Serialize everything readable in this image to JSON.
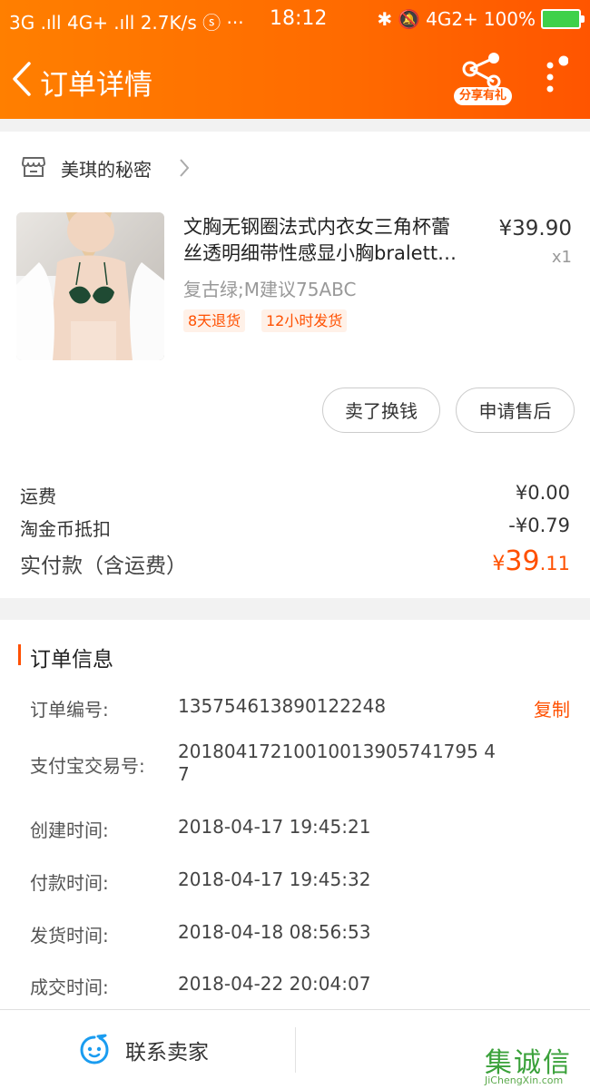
{
  "status_bar": {
    "left": "3G .ıll 4G+ .ıll 2.7K/s ⓢ ···",
    "time": "18:12",
    "network": "4G2+",
    "battery": "100%"
  },
  "header": {
    "title": "订单详情",
    "share_label": "分享有礼"
  },
  "shop": {
    "name": "美琪的秘密"
  },
  "product": {
    "title_line1": "文胸无钢圈法式内衣女三角杯蕾",
    "title_line2": "丝透明细带性感显小胸bralett…",
    "spec": "复古绿;M建议75ABC",
    "tags": [
      "8天退货",
      "12小时发货"
    ],
    "price": "¥39.90",
    "qty": "x1"
  },
  "actions": {
    "sell": "卖了换钱",
    "after_sale": "申请售后"
  },
  "fees": {
    "shipping_label": "运费",
    "shipping_value": "¥0.00",
    "coin_label": "淘金币抵扣",
    "coin_value": "-¥0.79",
    "total_label": "实付款（含运费）",
    "total_currency": "¥",
    "total_integer": "39",
    "total_decimal": ".11"
  },
  "order_info": {
    "section_title": "订单信息",
    "copy_label": "复制",
    "rows": [
      {
        "label": "订单编号:",
        "value": "135754613890122248"
      },
      {
        "label": "支付宝交易号:",
        "value_line1": "20180417210010013905741795 4",
        "value_line2": "7"
      },
      {
        "label": "创建时间:",
        "value": "2018-04-17 19:45:21"
      },
      {
        "label": "付款时间:",
        "value": "2018-04-17 19:45:32"
      },
      {
        "label": "发货时间:",
        "value": "2018-04-18 08:56:53"
      },
      {
        "label": "成交时间:",
        "value": "2018-04-22 20:04:07"
      }
    ]
  },
  "bottom": {
    "contact_label": "联系卖家",
    "watermark_chars": "集诚信",
    "watermark_url": "JiChengXin.com"
  },
  "colors": {
    "accent": "#ff5000",
    "header_start": "#ff7f00",
    "header_end": "#ff5500"
  }
}
